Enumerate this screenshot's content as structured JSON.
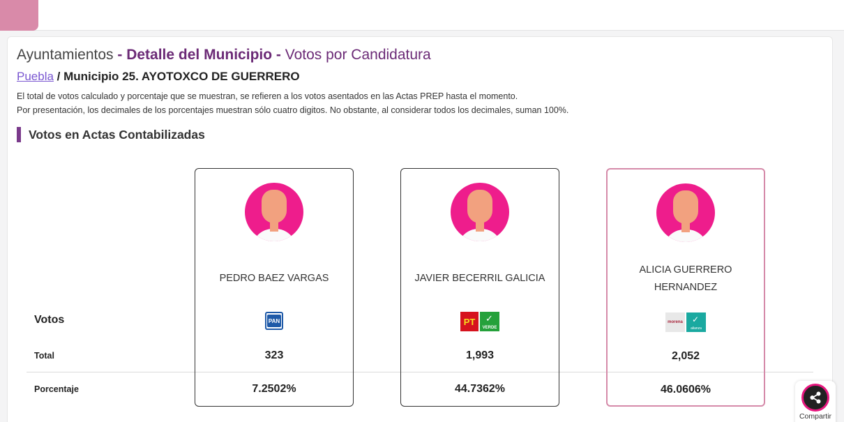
{
  "header": {
    "title_prefix": "Ayuntamientos",
    "title_sep1": " - ",
    "title_strong": "Detalle del Municipio",
    "title_sep2": " - ",
    "title_sub": "Votos por Candidatura"
  },
  "breadcrumb": {
    "link": "Puebla",
    "separator": " / ",
    "municipio": "Municipio 25. AYOTOXCO DE GUERRERO"
  },
  "notes": [
    "El total de votos calculado y porcentaje que se muestran, se refieren a los votos asentados en las Actas PREP hasta el momento.",
    "Por presentación, los decimales de los porcentajes muestran sólo cuatro digitos. No obstante, al considerar todos los decimales, suman 100%."
  ],
  "section": {
    "title": "Votos en Actas Contabilizadas"
  },
  "rows": {
    "votos": "Votos",
    "total": "Total",
    "porcentaje": "Porcentaje"
  },
  "candidates": [
    {
      "name_line1": "PEDRO BAEZ VARGAS",
      "name_line2": "",
      "party": "PAN",
      "total": "323",
      "percent": "7.2502%"
    },
    {
      "name_line1": "JAVIER BECERRIL GALICIA",
      "name_line2": "",
      "party_pt": "PT",
      "party_verde": "VERDE",
      "total": "1,993",
      "percent": "44.7362%"
    },
    {
      "name_line1": "ALICIA GUERRERO",
      "name_line2": "HERNANDEZ",
      "party_morena": "morena",
      "party_alianza": "alianza",
      "total": "2,052",
      "percent": "46.0606%"
    }
  ],
  "share": {
    "label": "Compartir"
  },
  "colors": {
    "accent": "#6b2a76",
    "avatar": "#ee1d8c",
    "winner_border": "#d58aa9"
  }
}
